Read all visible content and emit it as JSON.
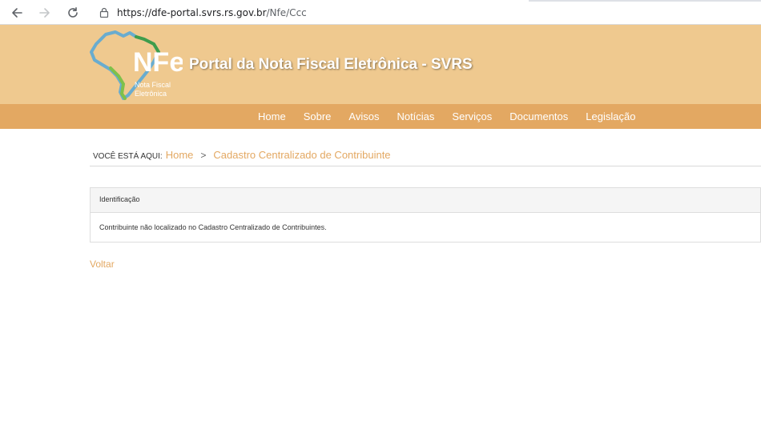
{
  "browser": {
    "url_host": "https://dfe-portal.svrs.rs.gov.br",
    "url_path": "/Nfe/Ccc"
  },
  "header": {
    "logo_text": "NFe",
    "logo_subtext": "Nota Fiscal Eletrônica",
    "site_title": "Portal da Nota Fiscal Eletrônica - SVRS",
    "background_color": "#efc98f"
  },
  "nav": {
    "items": [
      "Home",
      "Sobre",
      "Avisos",
      "Notícias",
      "Serviços",
      "Documentos",
      "Legislação"
    ],
    "background_color": "#e3a862"
  },
  "breadcrumb": {
    "label": "VOCÊ ESTÁ AQUI:",
    "home": "Home",
    "separator": ">",
    "current": "Cadastro Centralizado de Contribuinte"
  },
  "panel": {
    "heading": "Identificação",
    "message": "Contribuinte não localizado no Cadastro Centralizado de Contribuintes."
  },
  "voltar_label": "Voltar",
  "accent_color": "#e3a862"
}
